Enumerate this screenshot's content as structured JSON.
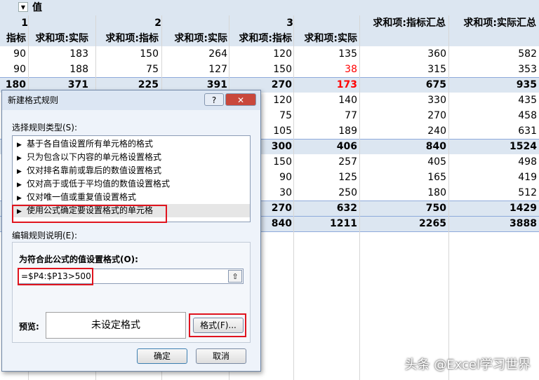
{
  "pivot": {
    "filter_label": "值",
    "group_numbers": [
      "1",
      "2",
      "3"
    ],
    "column_headers": [
      "指标",
      "求和项:实际",
      "求和项:指标",
      "求和项:实际",
      "求和项:指标",
      "求和项:实际"
    ],
    "grand_headers": [
      "求和项:指标汇总",
      "求和项:实际汇总"
    ],
    "rows": [
      [
        "90",
        "183",
        "150",
        "264",
        "120",
        "135",
        "360",
        "582"
      ],
      [
        "90",
        "188",
        "75",
        "127",
        "150",
        "38",
        "315",
        "353"
      ],
      [
        "180",
        "371",
        "225",
        "391",
        "270",
        "173",
        "675",
        "935"
      ],
      [
        "",
        "",
        "",
        "",
        "120",
        "140",
        "330",
        "435"
      ],
      [
        "",
        "",
        "",
        "",
        "75",
        "77",
        "270",
        "458"
      ],
      [
        "",
        "",
        "",
        "",
        "105",
        "189",
        "240",
        "631"
      ],
      [
        "",
        "",
        "",
        "",
        "300",
        "406",
        "840",
        "1524"
      ],
      [
        "",
        "",
        "",
        "",
        "150",
        "257",
        "405",
        "498"
      ],
      [
        "",
        "",
        "",
        "",
        "90",
        "125",
        "165",
        "419"
      ],
      [
        "",
        "",
        "",
        "",
        "30",
        "250",
        "180",
        "512"
      ],
      [
        "",
        "",
        "",
        "",
        "270",
        "632",
        "750",
        "1429"
      ],
      [
        "",
        "",
        "",
        "",
        "840",
        "1211",
        "2265",
        "3888"
      ]
    ],
    "bold_rows": [
      2,
      6,
      10,
      11
    ],
    "colors": {
      "header_band": "#dce6f1",
      "subtotal_band": "#dce6f1",
      "red_value": "#ff0000",
      "grid": "#d6d6d6"
    }
  },
  "dialog": {
    "title": "新建格式规则",
    "help_button": "?",
    "close_icon": "close-icon",
    "rule_type_label": "选择规则类型(S):",
    "rule_types": [
      "基于各自值设置所有单元格的格式",
      "只为包含以下内容的单元格设置格式",
      "仅对排名靠前或靠后的数值设置格式",
      "仅对高于或低于平均值的数值设置格式",
      "仅对唯一值或重复值设置格式",
      "使用公式确定要设置格式的单元格"
    ],
    "selected_rule_index": 5,
    "edit_label": "编辑规则说明(E):",
    "formula_label": "为符合此公式的值设置格式(O):",
    "formula_value": "=$P4:$P13>500",
    "preview_label": "预览:",
    "preview_text": "未设定格式",
    "format_button": "格式(F)...",
    "ok_button": "确定",
    "cancel_button": "取消",
    "highlight_color": "#e0141e"
  },
  "watermark": "头条 @Excel学习世界"
}
